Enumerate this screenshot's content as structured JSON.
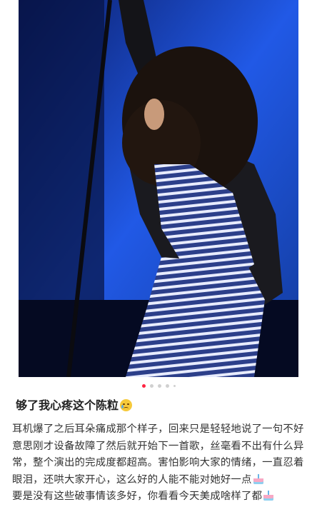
{
  "post": {
    "title": "够了我心疼这个陈粒",
    "title_emoji": "crying-face-emoji",
    "paragraph_1": "耳机爆了之后耳朵痛成那个样子，回来只是轻轻地说了一句不好意思刚才设备故障了然后就开始下一首歌，丝毫看不出有什么异常，整个演出的完成度都超高。害怕影响大家的情绪，一直忍着眼泪，还哄大家开心，这么好的人能不能对她好一点",
    "paragraph_2": "要是没有这些破事情该多好，你看看今天美成啥样了都",
    "inline_emoji": "cake-emoji"
  },
  "carousel": {
    "total": 5,
    "active_index": 0
  },
  "colors": {
    "accent": "#ff2442",
    "stage_blue": "#1f4fd8"
  }
}
